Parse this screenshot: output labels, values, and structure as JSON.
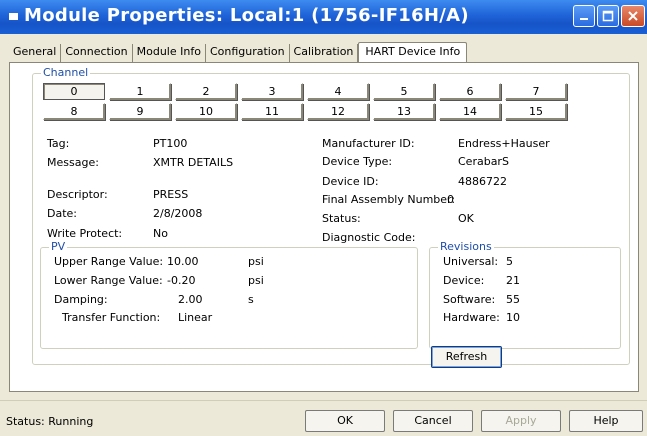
{
  "title": "Module Properties: Local:1 (1756-IF16H/A)",
  "tabs": [
    "General",
    "Connection",
    "Module Info",
    "Configuration",
    "Calibration",
    "HART Device Info"
  ],
  "channel": {
    "label": "Channel",
    "selected": "0",
    "row1": [
      "0",
      "1",
      "2",
      "3",
      "4",
      "5",
      "6",
      "7"
    ],
    "row2": [
      "8",
      "9",
      "10",
      "11",
      "12",
      "13",
      "14",
      "15"
    ]
  },
  "device": {
    "tag_label": "Tag:",
    "tag": "PT100",
    "message_label": "Message:",
    "message": "XMTR DETAILS",
    "descriptor_label": "Descriptor:",
    "descriptor": "PRESS",
    "date_label": "Date:",
    "date": "2/8/2008",
    "write_protect_label": "Write Protect:",
    "write_protect": "No",
    "manufacturer_label": "Manufacturer ID:",
    "manufacturer": "Endress+Hauser",
    "device_type_label": "Device Type:",
    "device_type": "CerabarS",
    "device_id_label": "Device ID:",
    "device_id": "4886722",
    "final_assembly_label": "Final Assembly Number:",
    "final_assembly": "0",
    "status_label": "Status:",
    "status": "OK",
    "diagnostic_label": "Diagnostic Code:",
    "diagnostic": ""
  },
  "pv": {
    "label": "PV",
    "urv_label": "Upper Range Value:",
    "urv": "10.00",
    "urv_unit": "psi",
    "lrv_label": "Lower Range Value:",
    "lrv": "-0.20",
    "lrv_unit": "psi",
    "damping_label": "Damping:",
    "damping": "2.00",
    "damping_unit": "s",
    "transfer_label": "Transfer Function:",
    "transfer": "Linear"
  },
  "revisions": {
    "label": "Revisions",
    "universal_label": "Universal:",
    "universal": "5",
    "device_label": "Device:",
    "device": "21",
    "software_label": "Software:",
    "software": "55",
    "hardware_label": "Hardware:",
    "hardware": "10"
  },
  "buttons": {
    "refresh": "Refresh",
    "ok": "OK",
    "cancel": "Cancel",
    "apply": "Apply",
    "help": "Help"
  },
  "status_bar": "Status:  Running"
}
